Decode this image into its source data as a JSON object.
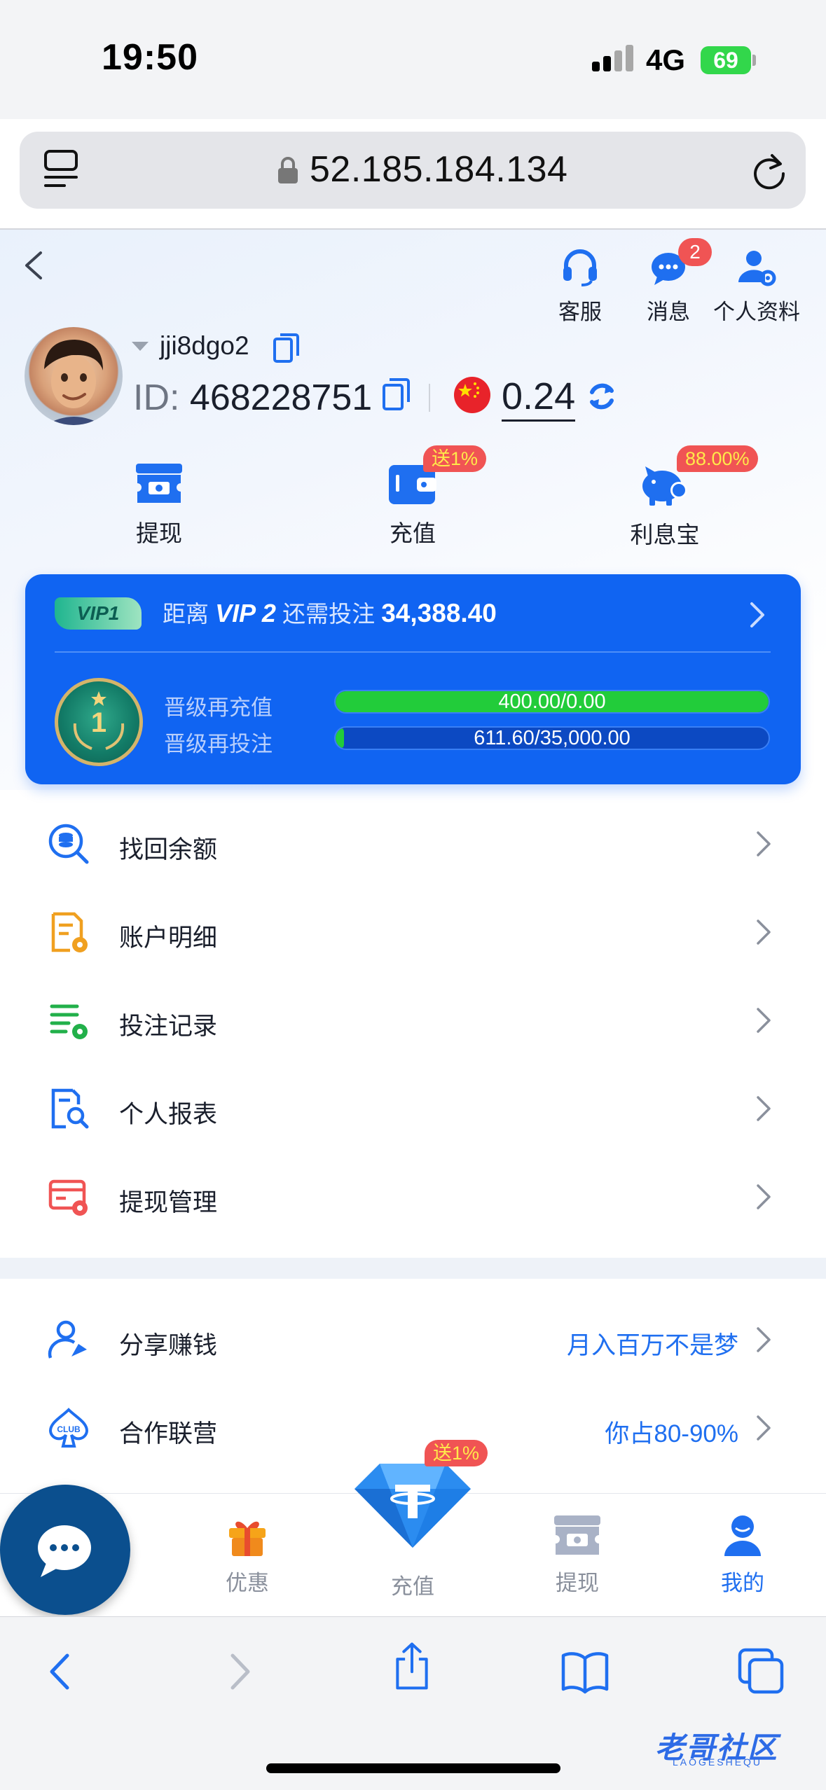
{
  "status_bar": {
    "time": "19:50",
    "network": "4G",
    "battery": "69"
  },
  "browser": {
    "url": "52.185.184.134"
  },
  "header": {
    "service_label": "客服",
    "message_label": "消息",
    "message_badge": "2",
    "profile_label": "个人资料"
  },
  "user": {
    "username": "jji8dgo2",
    "id_label": "ID:",
    "id": "468228751",
    "balance": "0.24"
  },
  "actions": {
    "withdraw": "提现",
    "deposit": "充值",
    "deposit_badge": "送1%",
    "interest": "利息宝",
    "interest_badge": "88.00%"
  },
  "vip": {
    "current": "VIP1",
    "prefix": "距离",
    "next_level": "VIP 2",
    "middle": "还需投注",
    "amount": "34,388.40",
    "level_num": "1",
    "recharge_label": "晋级再充值",
    "recharge_progress": "400.00/0.00",
    "recharge_fraction": 1.0,
    "bet_label": "晋级再投注",
    "bet_progress": "611.60/35,000.00",
    "bet_fraction": 0.0175
  },
  "menu": {
    "items": [
      {
        "label": "找回余额"
      },
      {
        "label": "账户明细"
      },
      {
        "label": "投注记录"
      },
      {
        "label": "个人报表"
      },
      {
        "label": "提现管理"
      }
    ],
    "items2": [
      {
        "label": "分享赚钱",
        "extra": "月入百万不是梦"
      },
      {
        "label": "合作联营",
        "extra": "你占80-90%"
      }
    ]
  },
  "bottom_nav": {
    "promo": "优惠",
    "deposit": "充值",
    "deposit_badge": "送1%",
    "withdraw": "提现",
    "mine": "我的"
  },
  "watermark": "老哥社区",
  "watermark_sub": "LAOGESHEQU",
  "colors": {
    "primary": "#1064f2",
    "accent_blue": "#1f6ff0",
    "badge_red": "#f05454",
    "progress_green": "#22cc3a"
  }
}
